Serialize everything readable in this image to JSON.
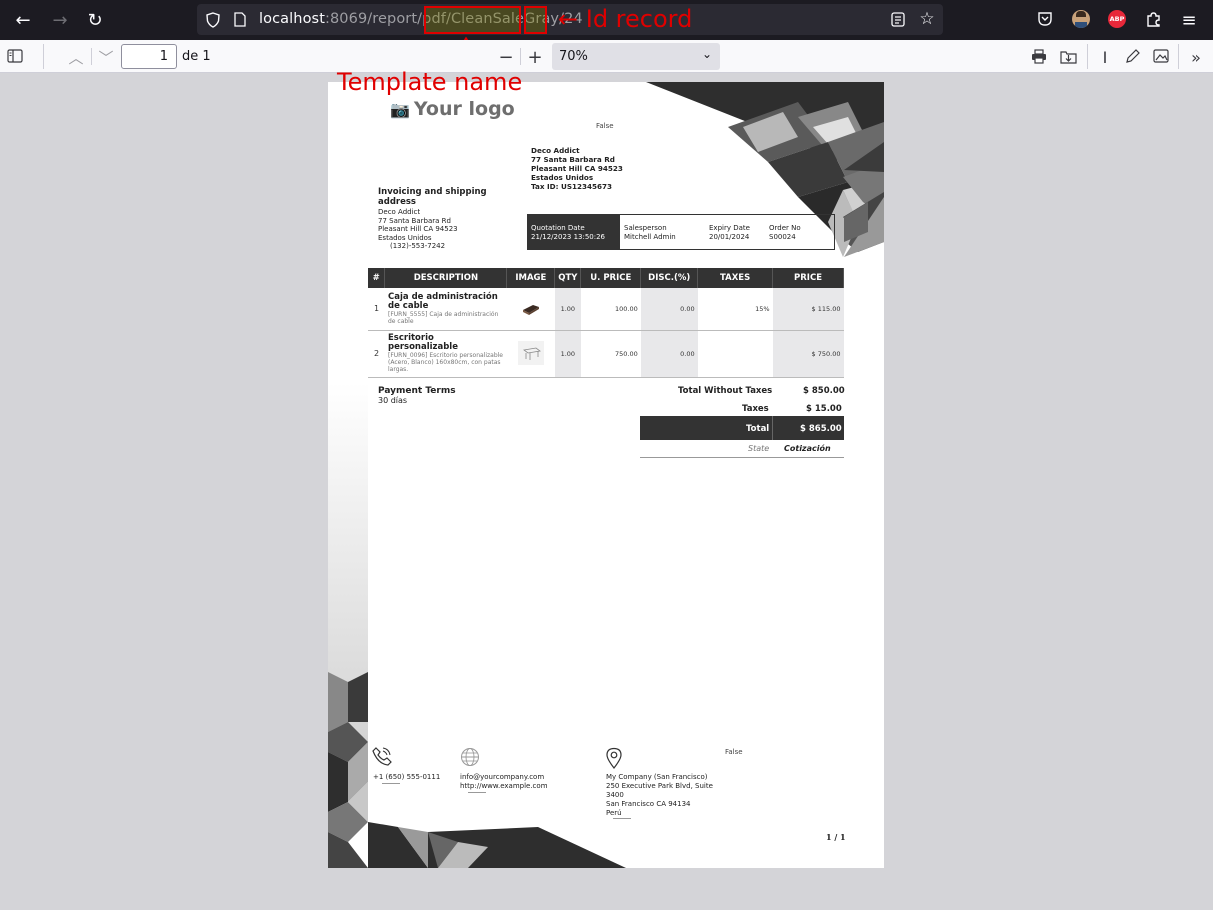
{
  "browser": {
    "url_host": "localhost",
    "url_port_path": ":8069/report/pdf/",
    "url_template": "CleanSaleGray",
    "url_sep": "/",
    "url_id": "24",
    "abp_label": "ABP"
  },
  "annotations": {
    "id_record": "← Id record",
    "template_name": "Template name"
  },
  "pdf_toolbar": {
    "page_value": "1",
    "page_of": "de 1",
    "zoom": "70%"
  },
  "document": {
    "logo_text": "Your logo",
    "false_label_top": "False",
    "company_address": [
      "Deco Addict",
      "77 Santa Barbara Rd",
      "Pleasant Hill CA 94523",
      "Estados Unidos",
      "Tax ID: US12345673"
    ],
    "invoice_title": "Invoicing and shipping address",
    "invoice_address": [
      "Deco Addict",
      "77 Santa Barbara Rd",
      "Pleasant Hill CA 94523",
      "Estados Unidos"
    ],
    "invoice_phone": "(132)-553-7242",
    "info": {
      "quotation_date_label": "Quotation Date",
      "quotation_date": "21/12/2023 13:50:26",
      "salesperson_label": "Salesperson",
      "salesperson": "Mitchell Admin",
      "expiry_label": "Expiry Date",
      "expiry": "20/01/2024",
      "order_label": "Order No",
      "order": "S00024"
    },
    "table_headers": [
      "#",
      "DESCRIPTION",
      "IMAGE",
      "QTY",
      "U. PRICE",
      "DISC.(%)",
      "TAXES",
      "PRICE"
    ],
    "lines": [
      {
        "n": "1",
        "name": "Caja de administración de cable",
        "desc": "[FURN_5555] Caja de administración de cable",
        "qty": "1.00",
        "unit": "100.00",
        "disc": "0.00",
        "tax": "15%",
        "price": "$ 115.00"
      },
      {
        "n": "2",
        "name": "Escritorio personalizable",
        "desc": "[FURN_0096] Escritorio personalizable (Acero, Blanco) 160x80cm, con patas largas.",
        "qty": "1.00",
        "unit": "750.00",
        "disc": "0.00",
        "tax": "",
        "price": "$ 750.00"
      }
    ],
    "payment_terms_label": "Payment Terms",
    "payment_terms": "30 días",
    "total_without_taxes_label": "Total Without Taxes",
    "total_without_taxes": "$ 850.00",
    "taxes_label": "Taxes",
    "taxes": "$ 15.00",
    "total_label": "Total",
    "total": "$ 865.00",
    "state_label": "State",
    "state": "Cotización",
    "footer": {
      "phone": "+1 (650) 555-0111",
      "email": "info@yourcompany.com",
      "website": "http://www.example.com",
      "company_address": [
        "My Company (San Francisco)",
        "250 Executive Park Blvd, Suite",
        "3400",
        "San Francisco CA 94134",
        "Perú"
      ],
      "false_label": "False",
      "page_number": "1 / 1"
    }
  },
  "colors": {
    "dark": "#333333",
    "annotation_red": "#e00000"
  }
}
